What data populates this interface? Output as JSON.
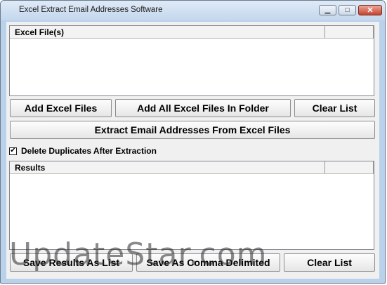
{
  "window": {
    "title": "Excel Extract Email Addresses Software",
    "minimize_glyph": "▁",
    "maximize_glyph": "□",
    "close_glyph": "✕"
  },
  "files_list": {
    "column_header": "Excel File(s)",
    "rows": []
  },
  "buttons": {
    "add_files": "Add Excel Files",
    "add_folder": "Add All Excel Files In Folder",
    "clear_files": "Clear List",
    "extract": "Extract Email Addresses From Excel Files",
    "save_list": "Save Results As List",
    "save_comma": "Save As Comma Delimited",
    "clear_results": "Clear List"
  },
  "options": {
    "delete_duplicates_label": "Delete Duplicates After Extraction",
    "delete_duplicates_checked": true,
    "check_glyph": "✔"
  },
  "results_list": {
    "column_header": "Results",
    "rows": []
  },
  "watermark": {
    "text": "UpdateStar.com"
  }
}
